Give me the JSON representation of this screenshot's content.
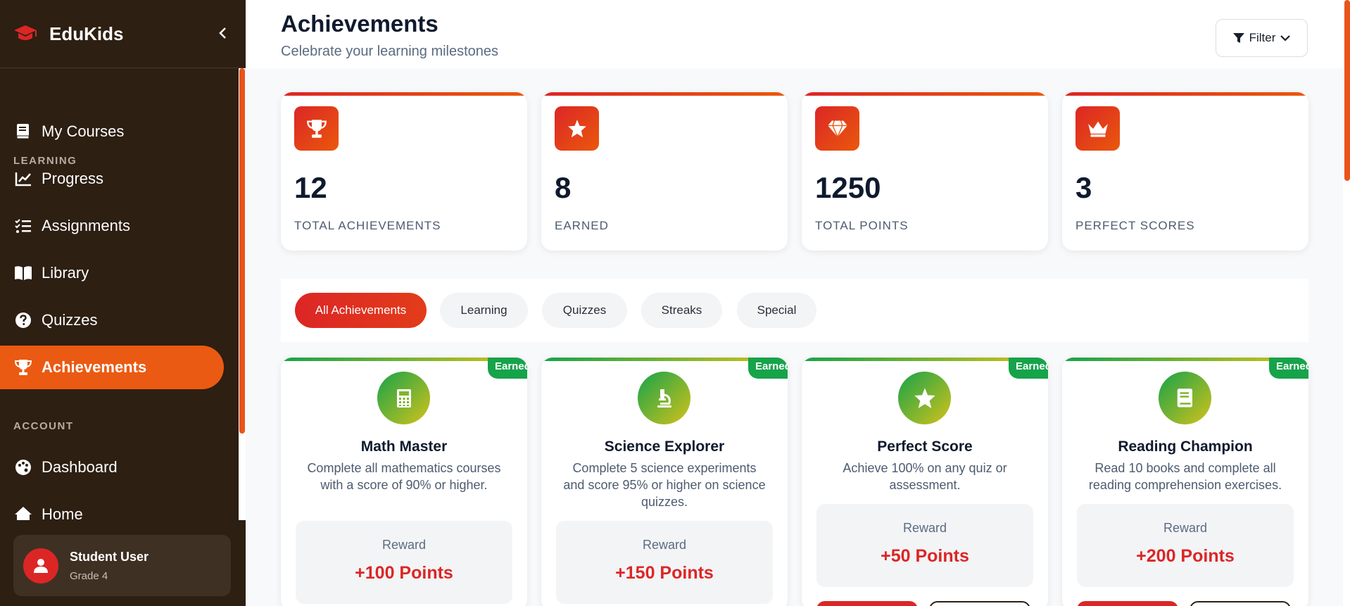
{
  "app": {
    "name": "EduKids"
  },
  "sidebar": {
    "sections": [
      {
        "label": "LEARNING",
        "items": [
          {
            "label": "My Courses",
            "icon": "book-icon"
          },
          {
            "label": "Progress",
            "icon": "chart-line-icon"
          },
          {
            "label": "Assignments",
            "icon": "tasks-icon"
          },
          {
            "label": "Library",
            "icon": "open-book-icon"
          },
          {
            "label": "Quizzes",
            "icon": "question-circle-icon"
          },
          {
            "label": "Achievements",
            "icon": "trophy-icon",
            "active": true
          }
        ]
      },
      {
        "label": "ACCOUNT",
        "items": [
          {
            "label": "Dashboard",
            "icon": "palette-icon"
          },
          {
            "label": "Home",
            "icon": "home-icon"
          }
        ]
      }
    ],
    "user": {
      "name": "Student User",
      "grade": "Grade 4"
    }
  },
  "header": {
    "title": "Achievements",
    "subtitle": "Celebrate your learning milestones",
    "filter_label": "Filter"
  },
  "stats": [
    {
      "value": "12",
      "label": "TOTAL ACHIEVEMENTS",
      "icon": "trophy-icon"
    },
    {
      "value": "8",
      "label": "EARNED",
      "icon": "star-icon"
    },
    {
      "value": "1250",
      "label": "TOTAL POINTS",
      "icon": "gem-icon"
    },
    {
      "value": "3",
      "label": "PERFECT SCORES",
      "icon": "crown-icon"
    }
  ],
  "tabs": [
    {
      "label": "All Achievements",
      "active": true
    },
    {
      "label": "Learning"
    },
    {
      "label": "Quizzes"
    },
    {
      "label": "Streaks"
    },
    {
      "label": "Special"
    }
  ],
  "achievements": [
    {
      "badge": "Earned",
      "title": "Math Master",
      "description": "Complete all mathematics courses with a score of 90% or higher.",
      "reward_label": "Reward",
      "reward": "+100 Points",
      "icon": "calculator-icon"
    },
    {
      "badge": "Earned",
      "title": "Science Explorer",
      "description": "Complete 5 science experiments and score 95% or higher on science quizzes.",
      "reward_label": "Reward",
      "reward": "+150 Points",
      "icon": "microscope-icon"
    },
    {
      "badge": "Earned",
      "title": "Perfect Score",
      "description": "Achieve 100% on any quiz or assessment.",
      "reward_label": "Reward",
      "reward": "+50 Points",
      "icon": "star-icon"
    },
    {
      "badge": "Earned",
      "title": "Reading Champion",
      "description": "Read 10 books and complete all reading comprehension exercises.",
      "reward_label": "Reward",
      "reward": "+200 Points",
      "icon": "book-icon"
    }
  ],
  "colors": {
    "sidebar_bg": "#2d1f12",
    "accent": "#eb5a12",
    "red": "#dc2626",
    "green": "#16a34a"
  }
}
